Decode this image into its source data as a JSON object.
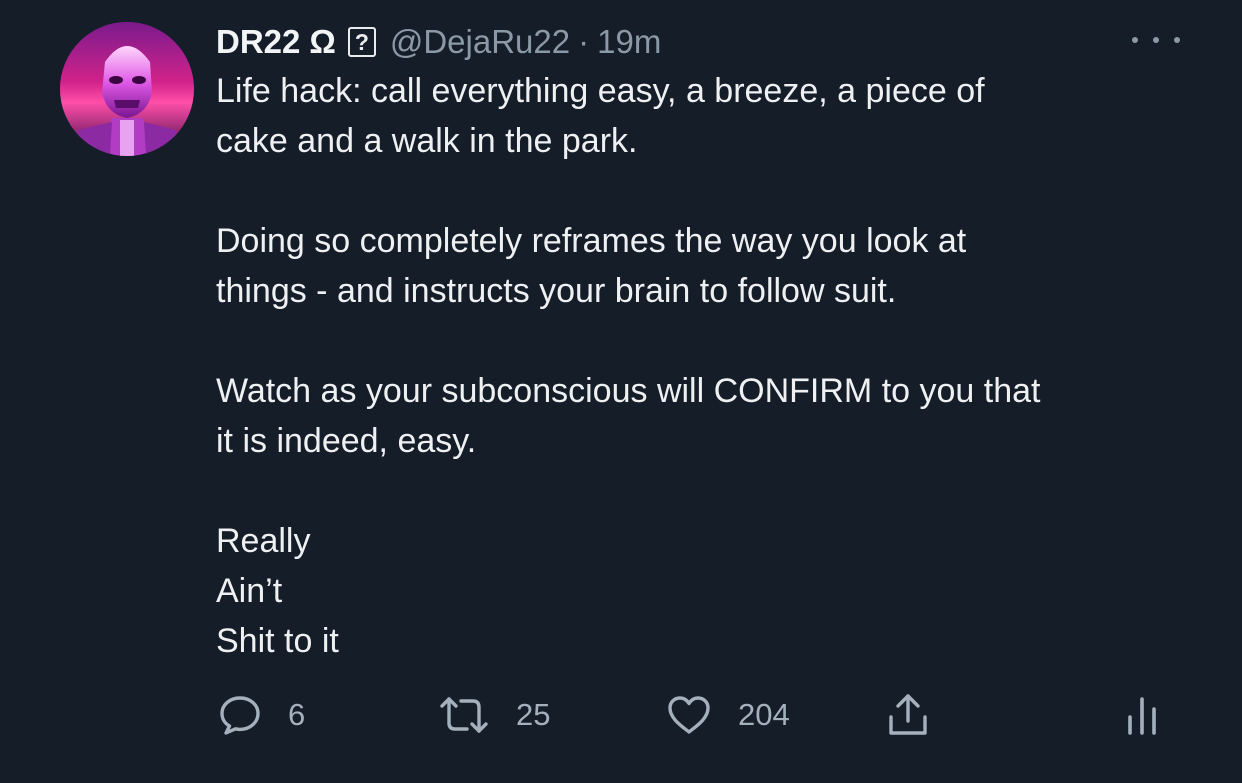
{
  "tweet": {
    "display_name": "DR22",
    "name_symbol": "Ω",
    "unknown_glyph": "?",
    "handle": "@DejaRu22",
    "separator": "·",
    "time": "19m",
    "body": {
      "paragraph_1": [
        "Life hack: call everything easy, a breeze, a piece of",
        "cake and a walk in the park."
      ],
      "paragraph_2": [
        "Doing so completely reframes the way you look at",
        "things - and instructs your brain to follow suit."
      ],
      "paragraph_3": [
        "Watch as your subconscious will CONFIRM to you that",
        "it is indeed, easy."
      ],
      "paragraph_4": [
        "Really",
        "Ain’t",
        "Shit to it"
      ]
    },
    "actions": {
      "reply_count": "6",
      "retweet_count": "25",
      "like_count": "204"
    }
  },
  "icons": {
    "avatar": "terminator-avatar",
    "more": "more-dots-icon",
    "reply": "reply-icon",
    "retweet": "retweet-icon",
    "like": "heart-icon",
    "share": "share-icon",
    "analytics": "analytics-icon"
  },
  "colors": {
    "background": "#151d29",
    "text": "#eef0f2",
    "muted": "#8b98a5",
    "avatar_accent": "#c92ad6"
  }
}
